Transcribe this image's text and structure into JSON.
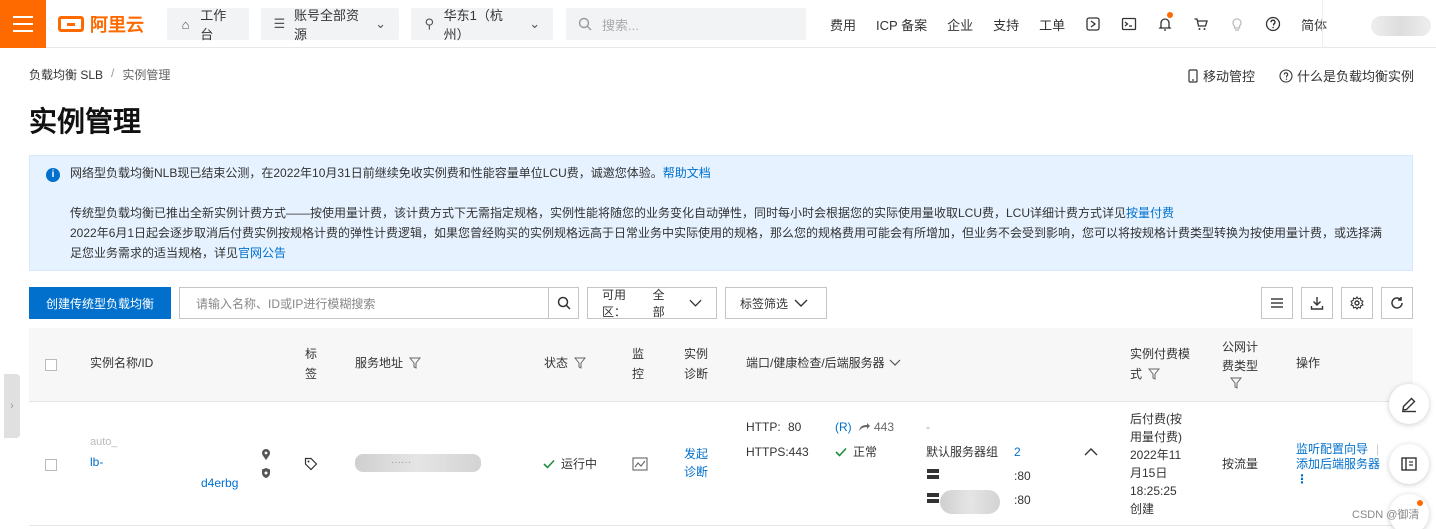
{
  "topbar": {
    "logo_text": "阿里云",
    "workbench": "工作台",
    "resources": "账号全部资源",
    "region": "华东1（杭州）",
    "search_placeholder": "搜索...",
    "links": [
      "费用",
      "ICP 备案",
      "企业",
      "支持",
      "工单"
    ],
    "lang": "简体"
  },
  "breadcrumb": {
    "root": "负载均衡 SLB",
    "sep": "/",
    "current": "实例管理"
  },
  "top_actions": {
    "mobile": "移动管控",
    "what_is": "什么是负载均衡实例"
  },
  "page_title": "实例管理",
  "notice": {
    "line1": "网络型负载均衡NLB现已结束公测，在2022年10月31日前继续免收实例费和性能容量单位LCU费，诚邀您体验。",
    "line1_link": "帮助文档",
    "line2": "传统型负载均衡已推出全新实例计费方式——按使用量计费，该计费方式下无需指定规格，实例性能将随您的业务变化自动弹性，同时每小时会根据您的实际使用量收取LCU费，LCU详细计费方式详见",
    "line2_link": "按量付费",
    "line3": "2022年6月1日起会逐步取消后付费实例按规格计费的弹性计费逻辑，如果您曾经购买的实例规格远高于日常业务中实际使用的规格，那么您的规格费用可能会有所增加，但业务不会受到影响，您可以将按规格计费类型转换为按使用量计费，或选择满",
    "line4": "足您业务需求的适当规格，详见",
    "line4_link": "官网公告"
  },
  "toolbar": {
    "create_button": "创建传统型负载均衡",
    "search_placeholder": "请输入名称、ID或IP进行模糊搜索",
    "zone_label": "可用区：",
    "zone_value": "全部",
    "tag_filter": "标签筛选"
  },
  "table": {
    "headers": {
      "name": "实例名称/ID",
      "tag1": "标",
      "tag2": "签",
      "address": "服务地址",
      "status": "状态",
      "monitor1": "监",
      "monitor2": "控",
      "diag1": "实例",
      "diag2": "诊断",
      "ports": "端口/健康检查/后端服务器",
      "billing1": "实例付费模",
      "billing2": "式",
      "net1": "公网计",
      "net2": "费类型",
      "ops": "操作"
    },
    "row": {
      "name_top": "auto_",
      "name_prefix": "lb-",
      "name_suffix": "d4erbg",
      "address_mask": "······",
      "status": "运行中",
      "diag1": "发起",
      "diag2": "诊断",
      "http_label": "HTTP:",
      "http_port": "80",
      "https_label": "HTTPS:443",
      "r_tag": "(R)",
      "redirect_port": "443",
      "health": "正常",
      "dash": "-",
      "server_group": "默认服务器组",
      "server_count": "2",
      "server_port1": ":80",
      "server_port2": ":80",
      "billing": [
        "后付费(按",
        "用量付费)",
        "2022年11",
        "月15日",
        "18:25:25",
        "创建"
      ],
      "net_type": "按流量",
      "op1": "监听配置向导",
      "op2": "添加后端服务器",
      "op_more": "⋮"
    }
  },
  "watermark": "CSDN @御清"
}
